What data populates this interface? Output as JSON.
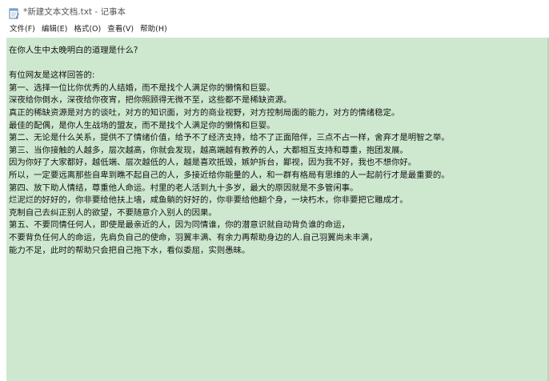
{
  "window": {
    "title": "*新建文本文档.txt - 记事本",
    "icon": "notepad-icon"
  },
  "menu": {
    "items": [
      "文件(F)",
      "编辑(E)",
      "格式(O)",
      "查看(V)",
      "帮助(H)"
    ]
  },
  "colors": {
    "editor_background": "#cde8cf",
    "text": "#141414"
  },
  "editor": {
    "lines": [
      "在你人生中太晚明白的道理是什么?",
      "",
      "有位网友是这样回答的:",
      "第一、选择一位比你优秀的人结婚，而不是找个人满足你的懒惰和巨婴。",
      "深夜给你倒水，深夜给你夜宵，把你照顾得无微不至，这些都不是稀缺资源。",
      "真正的稀缺资源是对方的谈吐，对方的知识面，对方的商业视野，对方控制局面的能力，对方的情绪稳定。",
      "最佳的配偶，是你人生战场的盟友，而不是找个人满足你的懒惰和巨婴。",
      "第二、无论是什么关系，提供不了情绪价值，给予不了经济支持，给不了正面陪伴，三点不占一样，舍弃才是明智之举。",
      "第三、当你接触的人越多，层次越高，你就会发现，越高端越有教养的人，大都相互支持和尊重，抱团发展。",
      "因为你好了大家都好，越低端、层次越低的人，越是喜欢抵毁，嫉妒拆台，鄙视，因为我不好，我也不想你好。",
      "所以，一定要远离那些自卑到瞧不起自己的人，多接近给你能量的人，和一群有格局有思维的人一起前行才是最重要的。",
      "第四、放下助人情结，尊重他人命运。村里的老人活到九十多岁，最大的原因就是不多管闲事。",
      "烂泥烂的好好的，你非要给他扶上墙，咸鱼躺的好好的，你非要给他翻个身，一块朽木，你非要把它雕成才。",
      "克制自己去纠正别人的欲望，不要随意介入别人的因果。",
      "第五、不要同情任何人，即使是最亲近的人，因为同情谁，你的潜意识就自动背负谁的命运，",
      "不要背负任何人的命运，先肩负自己的使命，羽翼丰满、有余力再帮助身边的人.自己羽翼尚未丰满，",
      "能力不足，此时的帮助只会把自己拖下水，看似委屈，实则愚昧。"
    ]
  }
}
